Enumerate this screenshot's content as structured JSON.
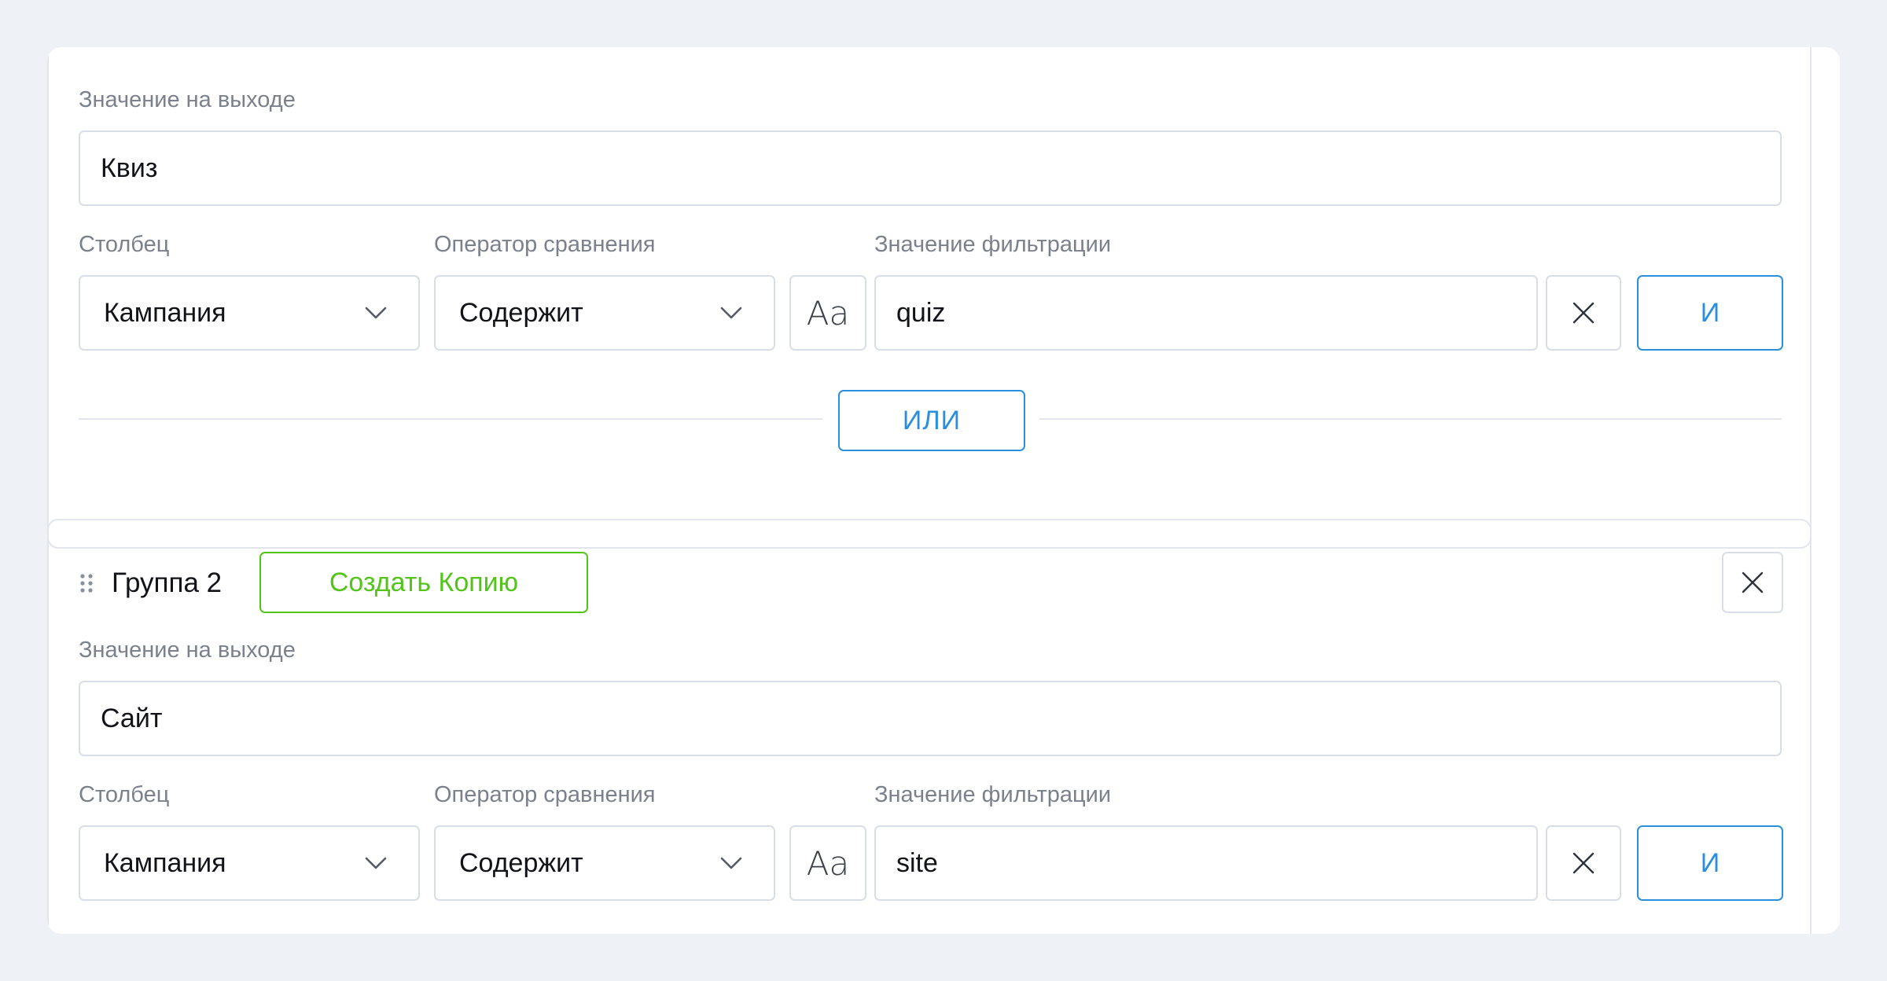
{
  "group1": {
    "output_label": "Значение на выходе",
    "output_value": "Квиз",
    "column_label": "Столбец",
    "column_value": "Кампания",
    "operator_label": "Оператор сравнения",
    "operator_value": "Содержит",
    "filter_label": "Значение фильтрации",
    "filter_value": "quiz",
    "case_icon_text": "Aa",
    "and_label": "И",
    "or_label": "ИЛИ"
  },
  "group2": {
    "title": "Группа 2",
    "copy_label": "Создать Копию",
    "output_label": "Значение на выходе",
    "output_value": "Сайт",
    "column_label": "Столбец",
    "column_value": "Кампания",
    "operator_label": "Оператор сравнения",
    "operator_value": "Содержит",
    "filter_label": "Значение фильтрации",
    "filter_value": "site",
    "case_icon_text": "Aa",
    "and_label": "И"
  },
  "colors": {
    "accent_blue": "#2a8fdd",
    "accent_green": "#52c41a",
    "border": "#d9dee6",
    "label_gray": "#7b818c",
    "background": "#eef1f5"
  },
  "icons": {
    "select": "chevron-down-icon",
    "case": "case-sensitive-icon",
    "clear": "close-icon",
    "drag": "drag-handle-icon",
    "remove_group": "close-icon"
  }
}
